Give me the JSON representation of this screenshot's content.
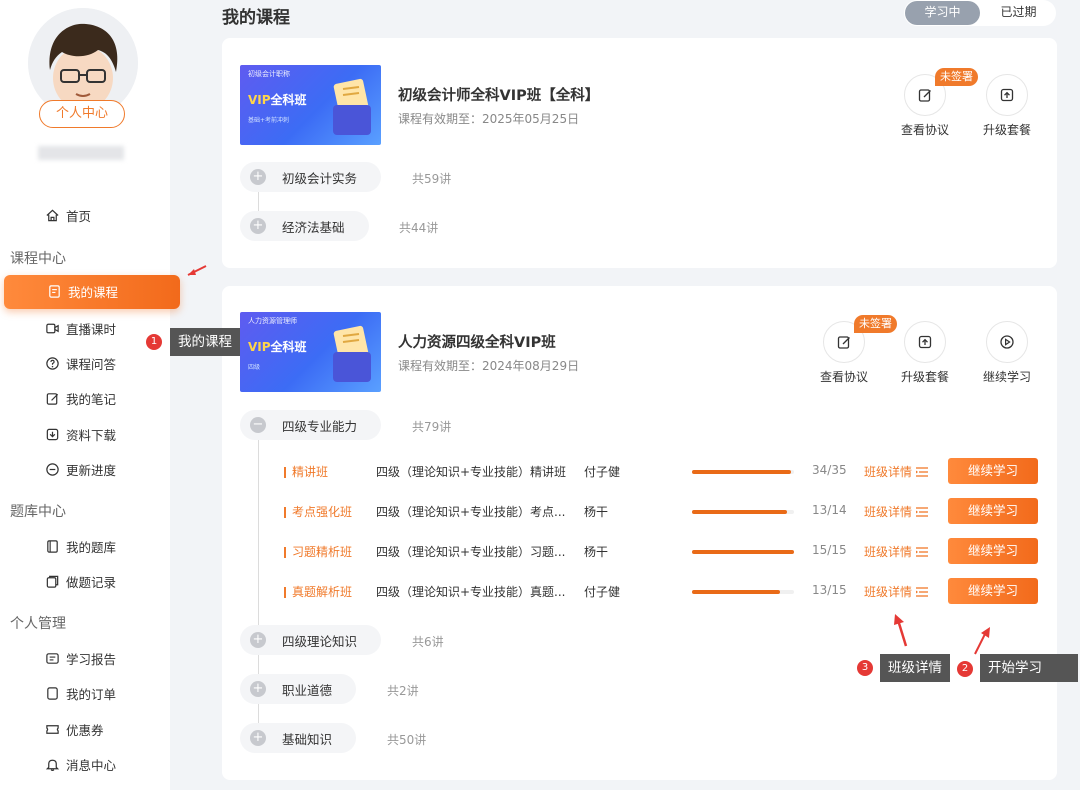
{
  "sidebar": {
    "profile_button": "个人中心",
    "home": "首页",
    "groups": [
      {
        "title": "课程中心",
        "items": [
          "我的课程",
          "直播课时",
          "课程问答",
          "我的笔记",
          "资料下载",
          "更新进度"
        ]
      },
      {
        "title": "题库中心",
        "items": [
          "我的题库",
          "做题记录"
        ]
      },
      {
        "title": "个人管理",
        "items": [
          "学习报告",
          "我的订单",
          "优惠券",
          "消息中心"
        ]
      }
    ]
  },
  "header": {
    "title": "我的课程",
    "tabs": [
      "学习中",
      "已过期"
    ]
  },
  "courses": [
    {
      "thumb_tag": "初级会计职称",
      "thumb_title_a": "VIP",
      "thumb_title_b": "全科班",
      "thumb_sub": "基础+考前冲刺",
      "title": "初级会计师全科VIP班【全科】",
      "valid": "课程有效期至：2025年05月25日",
      "actions": [
        "查看协议",
        "升级套餐"
      ],
      "badge": "未签署",
      "subjects": [
        {
          "name": "初级会计实务",
          "count": "共59讲"
        },
        {
          "name": "经济法基础",
          "count": "共44讲"
        }
      ]
    },
    {
      "thumb_tag": "人力资源管理师",
      "thumb_title_a": "VIP",
      "thumb_title_b": "全科班",
      "thumb_sub": "四级",
      "title": "人力资源四级全科VIP班",
      "valid": "课程有效期至：2024年08月29日",
      "actions": [
        "查看协议",
        "升级套餐",
        "继续学习"
      ],
      "badge": "未签署",
      "subjects": [
        {
          "name": "四级专业能力",
          "count": "共79讲"
        },
        {
          "name": "四级理论知识",
          "count": "共6讲"
        },
        {
          "name": "职业道德",
          "count": "共2讲"
        },
        {
          "name": "基础知识",
          "count": "共50讲"
        }
      ],
      "classes": [
        {
          "name": "精讲班",
          "desc": "四级（理论知识+专业技能）精讲班",
          "teacher": "付子健",
          "done": 34,
          "total": 35,
          "progress_text": "34/35",
          "detail": "班级详情",
          "button": "继续学习"
        },
        {
          "name": "考点强化班",
          "desc": "四级（理论知识+专业技能）考点...",
          "teacher": "杨干",
          "done": 13,
          "total": 14,
          "progress_text": "13/14",
          "detail": "班级详情",
          "button": "继续学习"
        },
        {
          "name": "习题精析班",
          "desc": "四级（理论知识+专业技能）习题...",
          "teacher": "杨干",
          "done": 15,
          "total": 15,
          "progress_text": "15/15",
          "detail": "班级详情",
          "button": "继续学习"
        },
        {
          "name": "真题解析班",
          "desc": "四级（理论知识+专业技能）真题...",
          "teacher": "付子健",
          "done": 13,
          "total": 15,
          "progress_text": "13/15",
          "detail": "班级详情",
          "button": "继续学习"
        }
      ]
    }
  ],
  "annotations": [
    {
      "num": "1",
      "text": "我的课程"
    },
    {
      "num": "2",
      "text": "开始学习"
    },
    {
      "num": "3",
      "text": "班级详情"
    }
  ],
  "colors": {
    "accent": "#f07a2b",
    "callout_bg": "#555555",
    "dot": "#e53935"
  }
}
